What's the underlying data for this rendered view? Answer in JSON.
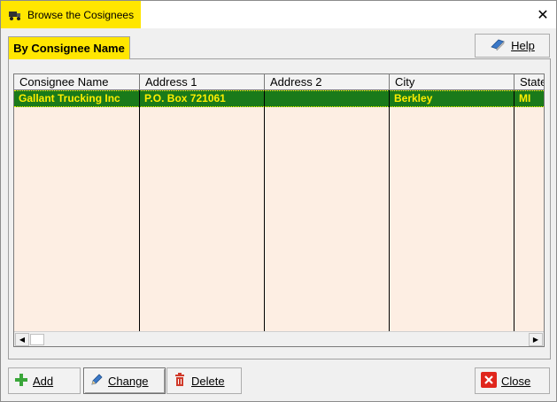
{
  "window": {
    "title": "Browse the Cosignees"
  },
  "tabs": [
    {
      "label": "By Consignee Name"
    }
  ],
  "toolbar": {
    "help_label": "Help"
  },
  "grid": {
    "columns": [
      "Consignee Name",
      "Address 1",
      "Address 2",
      "City",
      "State"
    ],
    "rows": [
      [
        "Gallant Trucking Inc",
        "P.O. Box 721061",
        "",
        "Berkley",
        "MI"
      ]
    ]
  },
  "buttons": {
    "add_label": "Add",
    "change_label": "Change",
    "delete_label": "Delete",
    "close_label": "Close"
  },
  "icons": {
    "app": "truck-icon",
    "close": "close-icon",
    "help": "book-icon",
    "add": "plus-icon",
    "change": "pencil-icon",
    "delete": "trash-icon",
    "close_btn": "red-x-icon"
  },
  "colors": {
    "title_highlight": "#ffe600",
    "tab_active": "#ffe600",
    "grid_background": "#fdeee3",
    "selected_row": "#1a7a1a",
    "selected_text": "#ffee00",
    "add_icon": "#3aa63a",
    "delete_icon": "#d03a2a",
    "close_icon": "#e0261c"
  }
}
